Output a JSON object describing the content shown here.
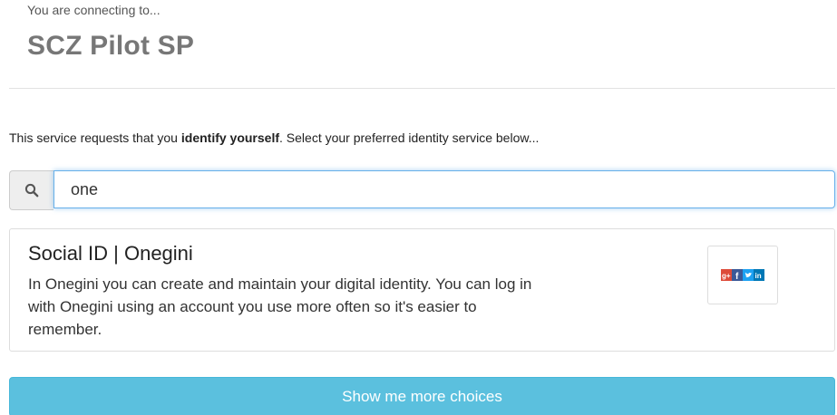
{
  "header": {
    "connecting_label": "You are connecting to...",
    "sp_name": "SCZ Pilot SP"
  },
  "intro": {
    "prefix": "This service requests that you ",
    "emphasis": "identify yourself",
    "suffix": ". Select your preferred identity service below..."
  },
  "search": {
    "icon": "search-icon",
    "value": "one"
  },
  "result": {
    "title": "Social ID | Onegini",
    "description": "In Onegini you can create and maintain your digital identity. You can log in with Onegini using an account you use more often so it's easier to remember.",
    "logo": {
      "icons": [
        "google-plus-icon",
        "facebook-icon",
        "twitter-icon",
        "linkedin-icon"
      ],
      "colors": {
        "google_plus": "#dd4b39",
        "facebook": "#3b5998",
        "twitter": "#1da1f2",
        "linkedin": "#0077b5"
      }
    }
  },
  "more_choices": {
    "label": "Show me more choices",
    "color": "#5bc0de"
  }
}
